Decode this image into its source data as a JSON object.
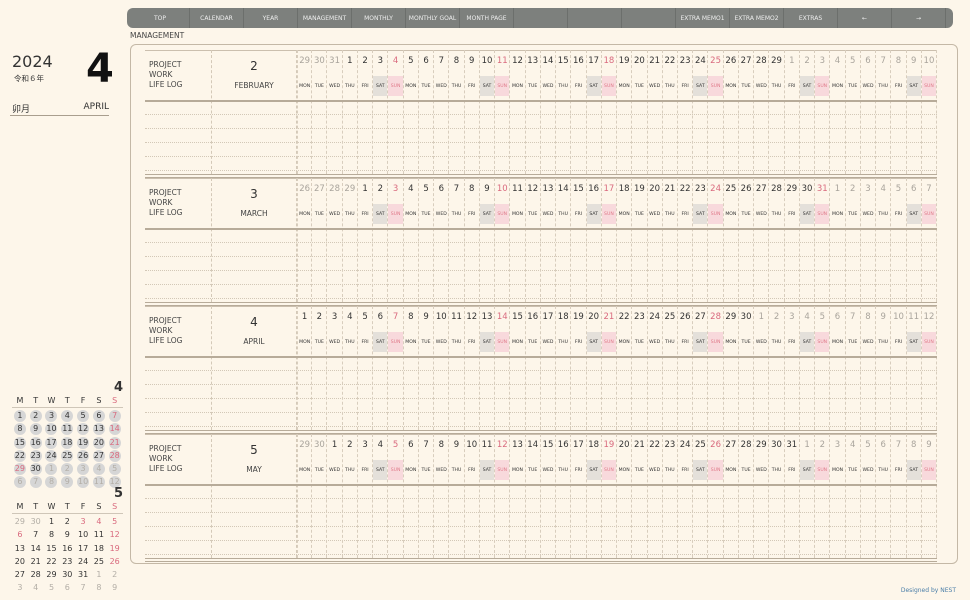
{
  "nav": {
    "items": [
      "TOP",
      "CALENDAR",
      "YEAR",
      "MANAGEMENT",
      "MONTHLY",
      "MONTHLY GOAL",
      "MONTH PAGE",
      "",
      "",
      "",
      "EXTRA MEMO1",
      "EXTRA MEMO2",
      "EXTRAS",
      "←",
      "→"
    ]
  },
  "section_title": "MANAGEMENT",
  "side": {
    "year": "2024",
    "era": "令和６年",
    "month": "4",
    "jp_month": "卯月",
    "en_month": "APRIL"
  },
  "labels": [
    "PROJECT",
    "WORK",
    "LIFE LOG"
  ],
  "weekdays": [
    "MON",
    "TUE",
    "WED",
    "THU",
    "FRI",
    "SAT",
    "SUN"
  ],
  "blocks": [
    {
      "month": "2",
      "name": "FEBRUARY",
      "in_month": [
        3,
        31
      ],
      "days": [
        29,
        30,
        31,
        1,
        2,
        3,
        4,
        5,
        6,
        7,
        8,
        9,
        10,
        11,
        12,
        13,
        14,
        15,
        16,
        17,
        18,
        19,
        20,
        21,
        22,
        23,
        24,
        25,
        26,
        27,
        28,
        29,
        1,
        2,
        3,
        4,
        5,
        6,
        7,
        8,
        9,
        10
      ]
    },
    {
      "month": "3",
      "name": "MARCH",
      "in_month": [
        4,
        34
      ],
      "days": [
        26,
        27,
        28,
        29,
        1,
        2,
        3,
        4,
        5,
        6,
        7,
        8,
        9,
        10,
        11,
        12,
        13,
        14,
        15,
        16,
        17,
        18,
        19,
        20,
        21,
        22,
        23,
        24,
        25,
        26,
        27,
        28,
        29,
        30,
        31,
        1,
        2,
        3,
        4,
        5,
        6,
        7
      ]
    },
    {
      "month": "4",
      "name": "APRIL",
      "in_month": [
        0,
        29
      ],
      "days": [
        1,
        2,
        3,
        4,
        5,
        6,
        7,
        8,
        9,
        10,
        11,
        12,
        13,
        14,
        15,
        16,
        17,
        18,
        19,
        20,
        21,
        22,
        23,
        24,
        25,
        26,
        27,
        28,
        29,
        30,
        1,
        2,
        3,
        4,
        5,
        6,
        7,
        8,
        9,
        10,
        11,
        12
      ]
    },
    {
      "month": "5",
      "name": "MAY",
      "in_month": [
        2,
        32
      ],
      "days": [
        29,
        30,
        1,
        2,
        3,
        4,
        5,
        6,
        7,
        8,
        9,
        10,
        11,
        12,
        13,
        14,
        15,
        16,
        17,
        18,
        19,
        20,
        21,
        22,
        23,
        24,
        25,
        26,
        27,
        28,
        29,
        30,
        31,
        1,
        2,
        3,
        4,
        5,
        6,
        7,
        8,
        9
      ]
    }
  ],
  "mini_weekdays": [
    "M",
    "T",
    "W",
    "T",
    "F",
    "S",
    "S"
  ],
  "mini": [
    {
      "month": "4",
      "in_month": [
        0,
        29
      ],
      "red": [
        6,
        13,
        20,
        27,
        28
      ],
      "circled": true,
      "days": [
        1,
        2,
        3,
        4,
        5,
        6,
        7,
        8,
        9,
        10,
        11,
        12,
        13,
        14,
        15,
        16,
        17,
        18,
        19,
        20,
        21,
        22,
        23,
        24,
        25,
        26,
        27,
        28,
        29,
        30,
        1,
        2,
        3,
        4,
        5,
        6,
        7,
        8,
        9,
        10,
        11,
        12
      ]
    },
    {
      "month": "5",
      "in_month": [
        2,
        32
      ],
      "red": [
        4,
        5,
        6,
        7,
        13,
        20,
        27
      ],
      "circled": false,
      "days": [
        29,
        30,
        1,
        2,
        3,
        4,
        5,
        6,
        7,
        8,
        9,
        10,
        11,
        12,
        13,
        14,
        15,
        16,
        17,
        18,
        19,
        20,
        21,
        22,
        23,
        24,
        25,
        26,
        27,
        28,
        29,
        30,
        31,
        1,
        2,
        3,
        4,
        5,
        6,
        7,
        8,
        9
      ]
    }
  ],
  "footer": "Designed by NEST",
  "colors": {
    "nav": "#7d807d",
    "sunday": "#d96a7e",
    "saturday_bg": "#e4e0da",
    "sunday_bg": "#f8d9dc"
  }
}
